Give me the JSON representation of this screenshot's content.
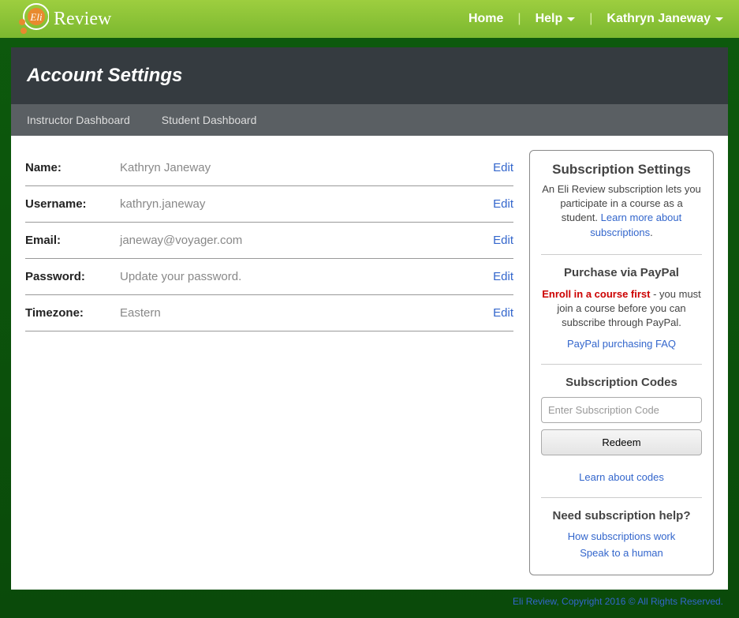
{
  "brand": "Review",
  "nav": {
    "home": "Home",
    "help": "Help",
    "user": "Kathryn Janeway"
  },
  "page_title": "Account Settings",
  "tabs": {
    "instructor": "Instructor Dashboard",
    "student": "Student Dashboard"
  },
  "settings": {
    "name_label": "Name:",
    "name_value": "Kathryn Janeway",
    "username_label": "Username:",
    "username_value": "kathryn.janeway",
    "email_label": "Email:",
    "email_value": "janeway@voyager.com",
    "password_label": "Password:",
    "password_value": "Update your password.",
    "timezone_label": "Timezone:",
    "timezone_value": "Eastern",
    "edit": "Edit"
  },
  "sidebar": {
    "subscription_heading": "Subscription Settings",
    "subscription_desc": "An Eli Review subscription lets you participate in a course as a student.",
    "learn_more": "Learn more about subscriptions",
    "paypal_heading": "Purchase via PayPal",
    "enroll_first": "Enroll in a course first",
    "enroll_rest": " - you must join a course before you can subscribe through PayPal.",
    "paypal_faq": "PayPal purchasing FAQ",
    "codes_heading": "Subscription Codes",
    "code_placeholder": "Enter Subscription Code",
    "redeem": "Redeem",
    "learn_codes": "Learn about codes",
    "help_heading": "Need subscription help?",
    "how_work": "How subscriptions work",
    "speak_human": "Speak to a human"
  },
  "footer": "Eli Review, Copyright 2016 © All Rights Reserved."
}
